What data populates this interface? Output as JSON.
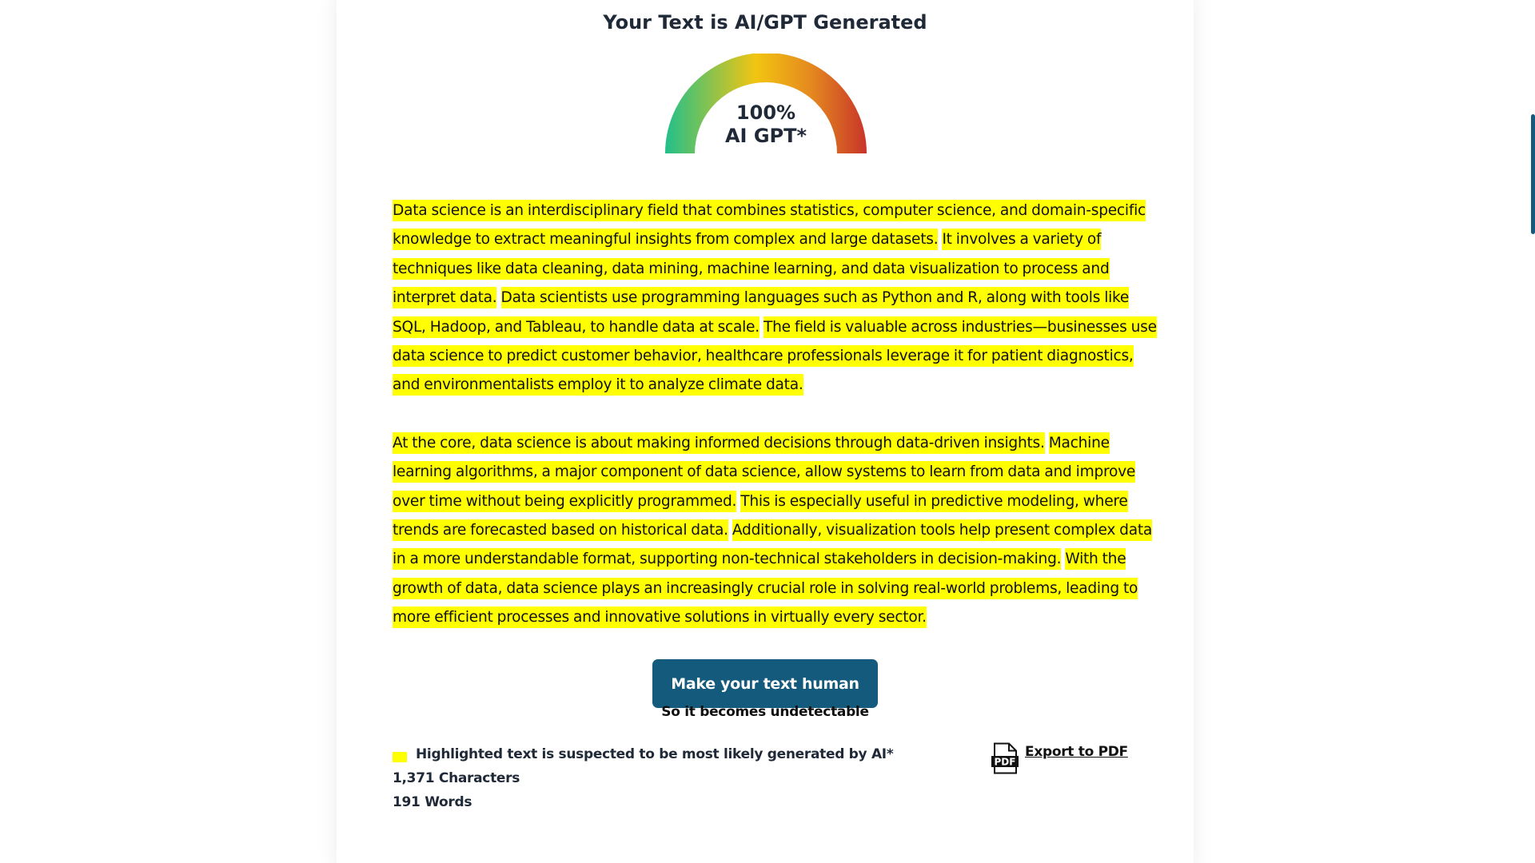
{
  "result": {
    "title": "Your Text is AI/GPT Generated",
    "gauge_value": "100%",
    "gauge_label": "AI GPT*",
    "gauge_percent": 100,
    "gauge_colors": [
      "#22c08a",
      "#f2c511",
      "#e58a1f",
      "#c8352a"
    ]
  },
  "analyzed_text": {
    "paragraphs": [
      {
        "sentences": [
          "Data science is an interdisciplinary field that combines statistics, computer science, and domain-specific knowledge to extract meaningful insights from complex and large datasets.",
          "It involves a variety of techniques like data cleaning, data mining, machine learning, and data visualization to process and interpret data.",
          "Data scientists use programming languages such as Python and R, along with tools like SQL, Hadoop, and Tableau, to handle data at scale.",
          "The field is valuable across industries—businesses use data science to predict customer behavior, healthcare professionals leverage it for patient diagnostics, and environmentalists employ it to analyze climate data."
        ]
      },
      {
        "sentences": [
          "At the core, data science is about making informed decisions through data-driven insights.",
          "Machine learning algorithms, a major component of data science, allow systems to learn from data and improve over time without being explicitly programmed.",
          "This is especially useful in predictive modeling, where trends are forecasted based on historical data.",
          "Additionally, visualization tools help present complex data in a more understandable format, supporting non-technical stakeholders in decision-making.",
          "With the growth of data, data science plays an increasingly crucial role in solving real-world problems, leading to more efficient processes and innovative solutions in virtually every sector."
        ]
      }
    ],
    "highlight_color": "#ffff00"
  },
  "cta": {
    "button_label": "Make your text human",
    "subtext": "So it becomes undetectable",
    "button_color": "#135a7d"
  },
  "footer": {
    "legend_text": "Highlighted text is suspected to be most likely generated by AI*",
    "characters": "1,371 Characters",
    "words": "191 Words",
    "export_label": "Export to PDF",
    "export_icon": "pdf-file-icon",
    "pdf_icon_text": "PDF"
  }
}
